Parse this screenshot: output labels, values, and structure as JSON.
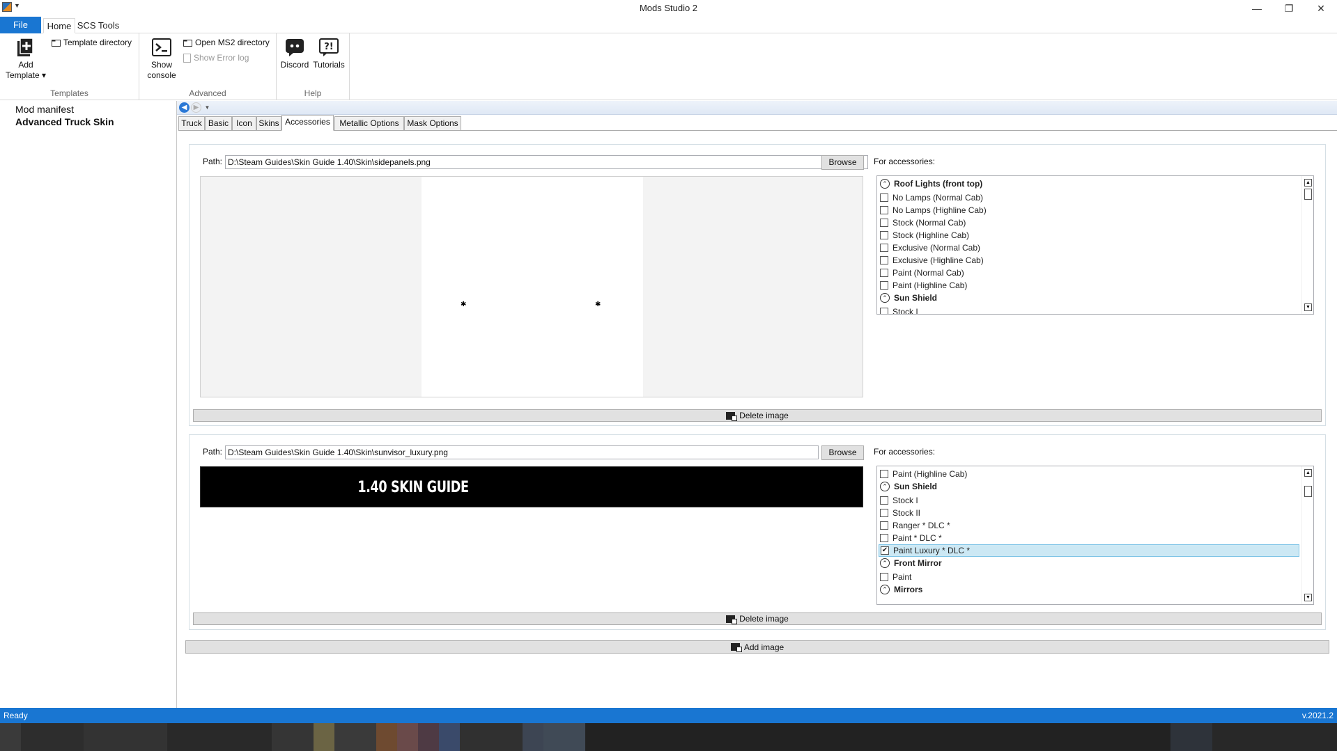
{
  "window": {
    "title": "Mods Studio 2",
    "minimize": "—",
    "restore": "❐",
    "close": "✕"
  },
  "ribbon_tabs": [
    "File",
    "Home",
    "SCS Tools"
  ],
  "ribbon": {
    "templates": {
      "add_template": "Add",
      "add_template_2": "Template ▾",
      "template_directory": "Template directory",
      "group_label": "Templates"
    },
    "advanced": {
      "show_console": "Show",
      "show_console_2": "console",
      "open_ms2_directory": "Open MS2 directory",
      "show_error_log": "Show Error log",
      "group_label": "Advanced"
    },
    "help": {
      "discord": "Discord",
      "tutorials": "Tutorials",
      "group_label": "Help"
    }
  },
  "tree": [
    "Mod manifest",
    "Advanced Truck Skin"
  ],
  "content_tabs": [
    "Truck",
    "Basic",
    "Icon",
    "Skins",
    "Accessories",
    "Metallic Options",
    "Mask Options"
  ],
  "active_tab": "Accessories",
  "entry1": {
    "path_label": "Path:",
    "path_value": "D:\\Steam Guides\\Skin Guide 1.40\\Skin\\sidepanels.png",
    "browse": "Browse",
    "accessories_label": "For accessories:",
    "delete": "Delete image",
    "list": [
      {
        "type": "header",
        "label": "Roof Lights (front top)"
      },
      {
        "type": "item",
        "label": "No Lamps (Normal Cab)",
        "checked": false
      },
      {
        "type": "item",
        "label": "No Lamps (Highline Cab)",
        "checked": false
      },
      {
        "type": "item",
        "label": "Stock (Normal Cab)",
        "checked": false
      },
      {
        "type": "item",
        "label": "Stock (Highline Cab)",
        "checked": false
      },
      {
        "type": "item",
        "label": "Exclusive (Normal Cab)",
        "checked": false
      },
      {
        "type": "item",
        "label": "Exclusive (Highline Cab)",
        "checked": false
      },
      {
        "type": "item",
        "label": "Paint (Normal Cab)",
        "checked": false
      },
      {
        "type": "item",
        "label": "Paint (Highline Cab)",
        "checked": false
      },
      {
        "type": "header",
        "label": "Sun Shield"
      },
      {
        "type": "item",
        "label": "Stock I",
        "checked": false
      }
    ]
  },
  "entry2": {
    "path_label": "Path:",
    "path_value": "D:\\Steam Guides\\Skin Guide 1.40\\Skin\\sunvisor_luxury.png",
    "browse": "Browse",
    "accessories_label": "For accessories:",
    "preview_text": "1.40 SKIN GUIDE",
    "delete": "Delete image",
    "list": [
      {
        "type": "item",
        "label": "Paint (Highline Cab)",
        "checked": false
      },
      {
        "type": "header",
        "label": "Sun Shield"
      },
      {
        "type": "item",
        "label": "Stock I",
        "checked": false
      },
      {
        "type": "item",
        "label": "Stock II",
        "checked": false
      },
      {
        "type": "item",
        "label": "Ranger * DLC *",
        "checked": false
      },
      {
        "type": "item",
        "label": "Paint * DLC *",
        "checked": false
      },
      {
        "type": "item",
        "label": "Paint Luxury * DLC *",
        "checked": true,
        "selected": true
      },
      {
        "type": "header",
        "label": "Front Mirror"
      },
      {
        "type": "item",
        "label": "Paint",
        "checked": false
      },
      {
        "type": "header",
        "label": "Mirrors"
      }
    ]
  },
  "add_image": "Add image",
  "status": {
    "left": "Ready",
    "right": "v.2021.2"
  },
  "colors": {
    "accent": "#1976d2",
    "selection": "#cce8f4"
  }
}
